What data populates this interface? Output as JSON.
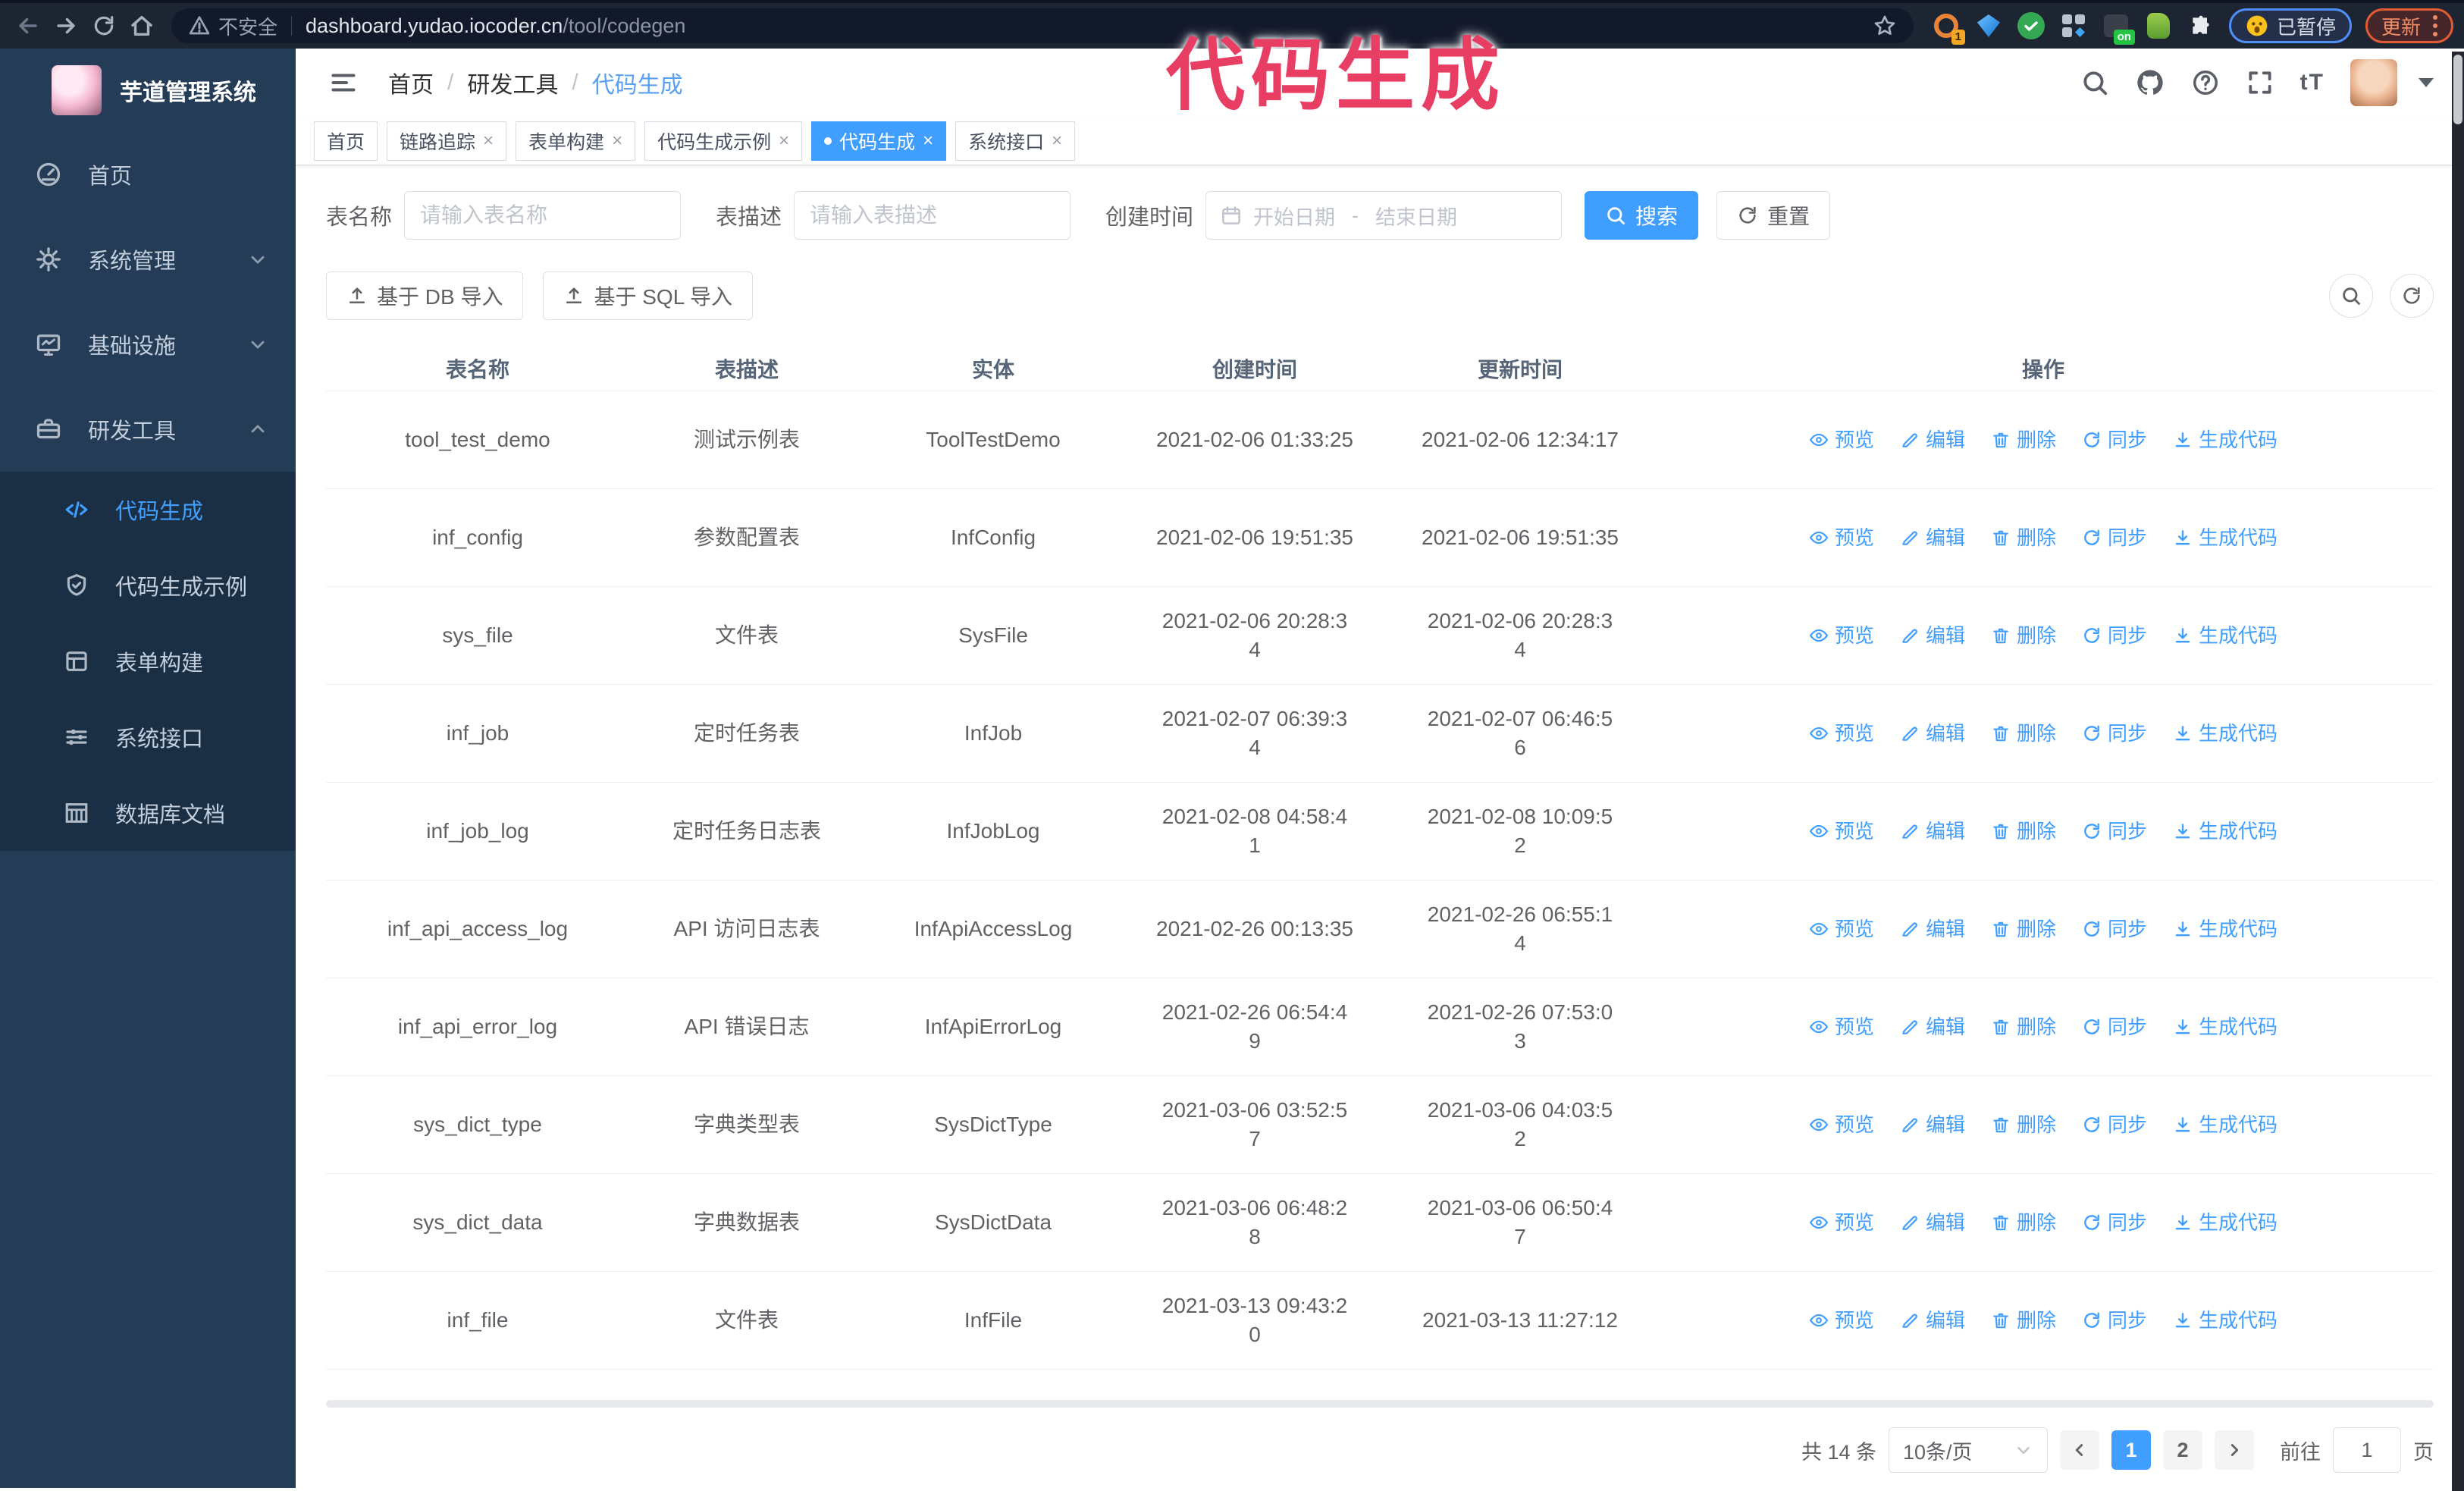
{
  "colors": {
    "accent": "#409eff",
    "annotation": "#e83e63",
    "sidebar_bg": "#243c55",
    "submenu_bg": "#1b2f44",
    "browser_bar_bg": "#1d2533"
  },
  "icons": {
    "back-icon": "left arrow",
    "forward-icon": "right arrow",
    "reload-icon": "circular arrow",
    "home-icon": "house",
    "warning-icon": "triangle !",
    "star-icon": "bookmark star",
    "puzzle-icon": "extensions puzzle piece",
    "search-icon": "magnifier",
    "github-icon": "octocat",
    "help-icon": "question circle",
    "fullscreen-icon": "expand corners",
    "font-size-icon": "tT",
    "calendar-icon": "calendar",
    "eye-icon": "preview eye",
    "edit-icon": "pencil",
    "delete-icon": "trash",
    "sync-icon": "circular arrows",
    "download-icon": "arrow into tray",
    "upload-icon": "arrow up from tray",
    "hamburger-icon": "three lines",
    "chevron": "angle"
  },
  "annotation": {
    "title": "代码生成"
  },
  "browser": {
    "security_label": "不安全",
    "url_host": "dashboard.yudao.iocoder.cn",
    "url_path": "/tool/codegen",
    "extension_badge_1": "1",
    "extension_badge_on": "on",
    "paused_label": "已暂停",
    "update_label": "更新"
  },
  "sidebar": {
    "app_title": "芋道管理系统",
    "items": [
      {
        "icon": "dashboard-icon",
        "label": "首页"
      },
      {
        "icon": "gear-icon",
        "label": "系统管理",
        "state": "collapsed"
      },
      {
        "icon": "monitor-icon",
        "label": "基础设施",
        "state": "collapsed"
      },
      {
        "icon": "toolbox-icon",
        "label": "研发工具",
        "state": "expanded"
      }
    ],
    "sub_items": [
      {
        "icon": "code-icon",
        "label": "代码生成",
        "active": true
      },
      {
        "icon": "shield-check-icon",
        "label": "代码生成示例"
      },
      {
        "icon": "form-icon",
        "label": "表单构建"
      },
      {
        "icon": "sliders-icon",
        "label": "系统接口"
      },
      {
        "icon": "db-table-icon",
        "label": "数据库文档"
      }
    ]
  },
  "header": {
    "breadcrumb": [
      "首页",
      "研发工具",
      "代码生成"
    ],
    "separator": "/"
  },
  "tabs": [
    {
      "label": "首页",
      "closable": false,
      "active": false
    },
    {
      "label": "链路追踪",
      "closable": true,
      "active": false
    },
    {
      "label": "表单构建",
      "closable": true,
      "active": false
    },
    {
      "label": "代码生成示例",
      "closable": true,
      "active": false
    },
    {
      "label": "代码生成",
      "closable": true,
      "active": true
    },
    {
      "label": "系统接口",
      "closable": true,
      "active": false
    }
  ],
  "search": {
    "name_label": "表名称",
    "name_placeholder": "请输入表名称",
    "desc_label": "表描述",
    "desc_placeholder": "请输入表描述",
    "date_label": "创建时间",
    "date_start_placeholder": "开始日期",
    "date_separator": "-",
    "date_end_placeholder": "结束日期",
    "search_button": "搜索",
    "reset_button": "重置"
  },
  "toolbar": {
    "db_import": "基于 DB 导入",
    "sql_import": "基于 SQL 导入"
  },
  "table": {
    "columns": [
      "表名称",
      "表描述",
      "实体",
      "创建时间",
      "更新时间",
      "操作"
    ],
    "actions": [
      "预览",
      "编辑",
      "删除",
      "同步",
      "生成代码"
    ],
    "rows": [
      {
        "name": "tool_test_demo",
        "desc": "测试示例表",
        "entity": "ToolTestDemo",
        "created": "2021-02-06 01:33:25",
        "updated": "2021-02-06 12:34:17"
      },
      {
        "name": "inf_config",
        "desc": "参数配置表",
        "entity": "InfConfig",
        "created": "2021-02-06 19:51:35",
        "updated": "2021-02-06 19:51:35"
      },
      {
        "name": "sys_file",
        "desc": "文件表",
        "entity": "SysFile",
        "created": "2021-02-06 20:28:3\n4",
        "updated": "2021-02-06 20:28:3\n4"
      },
      {
        "name": "inf_job",
        "desc": "定时任务表",
        "entity": "InfJob",
        "created": "2021-02-07 06:39:3\n4",
        "updated": "2021-02-07 06:46:5\n6"
      },
      {
        "name": "inf_job_log",
        "desc": "定时任务日志表",
        "entity": "InfJobLog",
        "created": "2021-02-08 04:58:4\n1",
        "updated": "2021-02-08 10:09:5\n2"
      },
      {
        "name": "inf_api_access_log",
        "desc": "API 访问日志表",
        "entity": "InfApiAccessLog",
        "created": "2021-02-26 00:13:35",
        "updated": "2021-02-26 06:55:1\n4"
      },
      {
        "name": "inf_api_error_log",
        "desc": "API 错误日志",
        "entity": "InfApiErrorLog",
        "created": "2021-02-26 06:54:4\n9",
        "updated": "2021-02-26 07:53:0\n3"
      },
      {
        "name": "sys_dict_type",
        "desc": "字典类型表",
        "entity": "SysDictType",
        "created": "2021-03-06 03:52:5\n7",
        "updated": "2021-03-06 04:03:5\n2"
      },
      {
        "name": "sys_dict_data",
        "desc": "字典数据表",
        "entity": "SysDictData",
        "created": "2021-03-06 06:48:2\n8",
        "updated": "2021-03-06 06:50:4\n7"
      },
      {
        "name": "inf_file",
        "desc": "文件表",
        "entity": "InfFile",
        "created": "2021-03-13 09:43:2\n0",
        "updated": "2021-03-13 11:27:12"
      }
    ]
  },
  "pagination": {
    "total": "共 14 条",
    "page_size": "10条/页",
    "pages": [
      "1",
      "2"
    ],
    "active_page": "1",
    "goto_label": "前往",
    "goto_value": "1",
    "page_unit": "页"
  }
}
